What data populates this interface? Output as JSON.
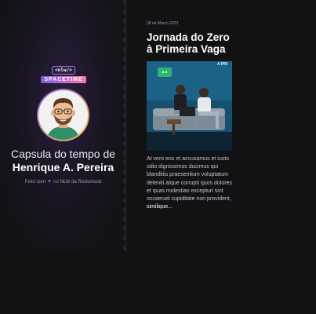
{
  "left_panel": {
    "nlw_tag": "<nlw/>",
    "brand": "SPACETIME",
    "capsule_title": "Capsula do tempo de",
    "capsule_name": "Henrique A. Pereira",
    "made_with_prefix": "Feito com",
    "made_with_suffix": "no NLW da Rocketseat"
  },
  "memory": {
    "date": "28 de Março 2023",
    "title": "Jornada do Zero à Primeira Vaga",
    "photo_sign_text": "A PRI",
    "body": "At vero eos et accusamus et iusto odio dignissimos ducimus qui blanditiis praesentium voluptatum deleniti atque corrupti quos dolores et quas molestias excepturi sint occaecati cupiditate non provident,",
    "body_last": "similique..."
  },
  "colors": {
    "background": "#121215",
    "accent_purple": "#8257e5",
    "accent_pink": "#f67ba8",
    "accent_yellow": "#f6c343"
  }
}
